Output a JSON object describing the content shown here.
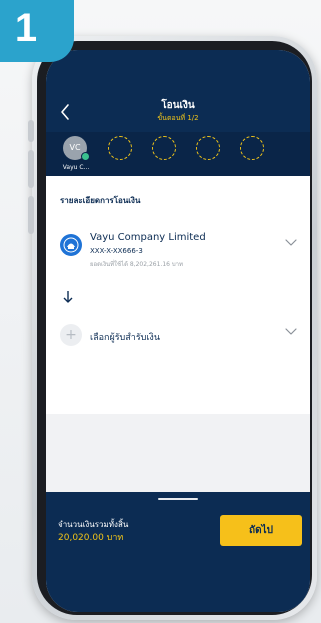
{
  "badge": {
    "number": "1"
  },
  "header": {
    "title": "โอนเงิน",
    "step": "ขั้นตอนที่ 1/2"
  },
  "recipients": {
    "active": {
      "initials": "VC",
      "name": "Vayu C..."
    },
    "empty_slots": 4
  },
  "details": {
    "section_title": "รายละเอียดการโอนเงิน",
    "sender": {
      "name": "Vayu Company Limited",
      "account": "XXX-X-XX666-3",
      "balance": "ยอดเงินที่ใช้ได้ 8,202,261.16 บาท"
    },
    "receiver": {
      "label": "เลือกผู้รับสำรับเงิน"
    }
  },
  "footer": {
    "total_label": "จำนวนเงินรวมทั้งสิ้น",
    "total_value": "20,020.00 บาท",
    "next_label": "ถัดไป"
  },
  "colors": {
    "navy": "#0c2c53",
    "gold": "#f6c01a",
    "badge": "#2ba3cc"
  },
  "icons": [
    "back-arrow-icon",
    "bank-logo-icon",
    "chevron-down-icon",
    "arrow-down-icon",
    "plus-icon"
  ]
}
